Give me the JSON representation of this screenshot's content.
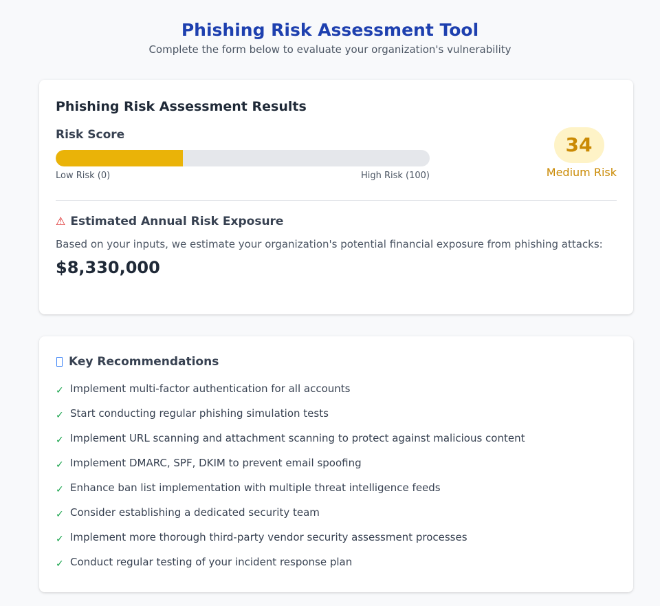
{
  "header": {
    "title": "Phishing Risk Assessment Tool",
    "subtitle": "Complete the form below to evaluate your organization's vulnerability"
  },
  "results": {
    "title": "Phishing Risk Assessment Results",
    "risk_score_label": "Risk Score",
    "score": 34,
    "score_text": "34",
    "level": "Medium Risk",
    "low_label": "Low Risk (0)",
    "high_label": "High Risk (100)",
    "bar_color": "#eab308",
    "level_color": "#ca8a04"
  },
  "exposure": {
    "icon": "warning-icon",
    "icon_glyph": "⚠",
    "title": "Estimated Annual Risk Exposure",
    "description": "Based on your inputs, we estimate your organization's potential financial exposure from phishing attacks:",
    "amount": "$8,330,000"
  },
  "recommendations": {
    "icon": "lightbulb-icon",
    "title": "Key Recommendations",
    "check_glyph": "✓",
    "items": [
      "Implement multi-factor authentication for all accounts",
      "Start conducting regular phishing simulation tests",
      "Implement URL scanning and attachment scanning to protect against malicious content",
      "Implement DMARC, SPF, DKIM to prevent email spoofing",
      "Enhance ban list implementation with multiple threat intelligence feeds",
      "Consider establishing a dedicated security team",
      "Implement more thorough third-party vendor security assessment processes",
      "Conduct regular testing of your incident response plan"
    ]
  },
  "colors": {
    "title_blue": "#1e40af",
    "check_green": "#16a34a",
    "warning_red": "#dc2626"
  }
}
